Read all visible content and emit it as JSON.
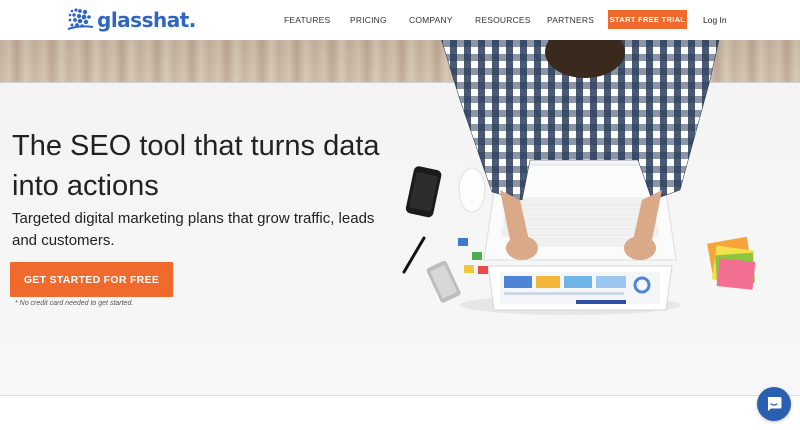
{
  "brand": {
    "name": "glasshat.",
    "color": "#2f66c2",
    "icon": "glasshat-dots-logo"
  },
  "nav": {
    "items": [
      "FEATURES",
      "PRICING",
      "COMPANY",
      "RESOURCES",
      "PARTNERS"
    ],
    "cta_label": "START FREE TRIAL",
    "login_label": "Log In"
  },
  "hero": {
    "title": "The SEO tool that turns data into actions",
    "subtitle": "Targeted digital marketing plans that grow traffic, leads and customers.",
    "cta_label": "GET STARTED FOR FREE",
    "note": "* No credit card needed to get started.",
    "image": "person-working-on-laptop-photo"
  },
  "chat": {
    "icon": "chat-bubble-icon"
  },
  "colors": {
    "accent": "#ef6a2c",
    "brand": "#2f66c2",
    "chat": "#2b5fb0"
  }
}
